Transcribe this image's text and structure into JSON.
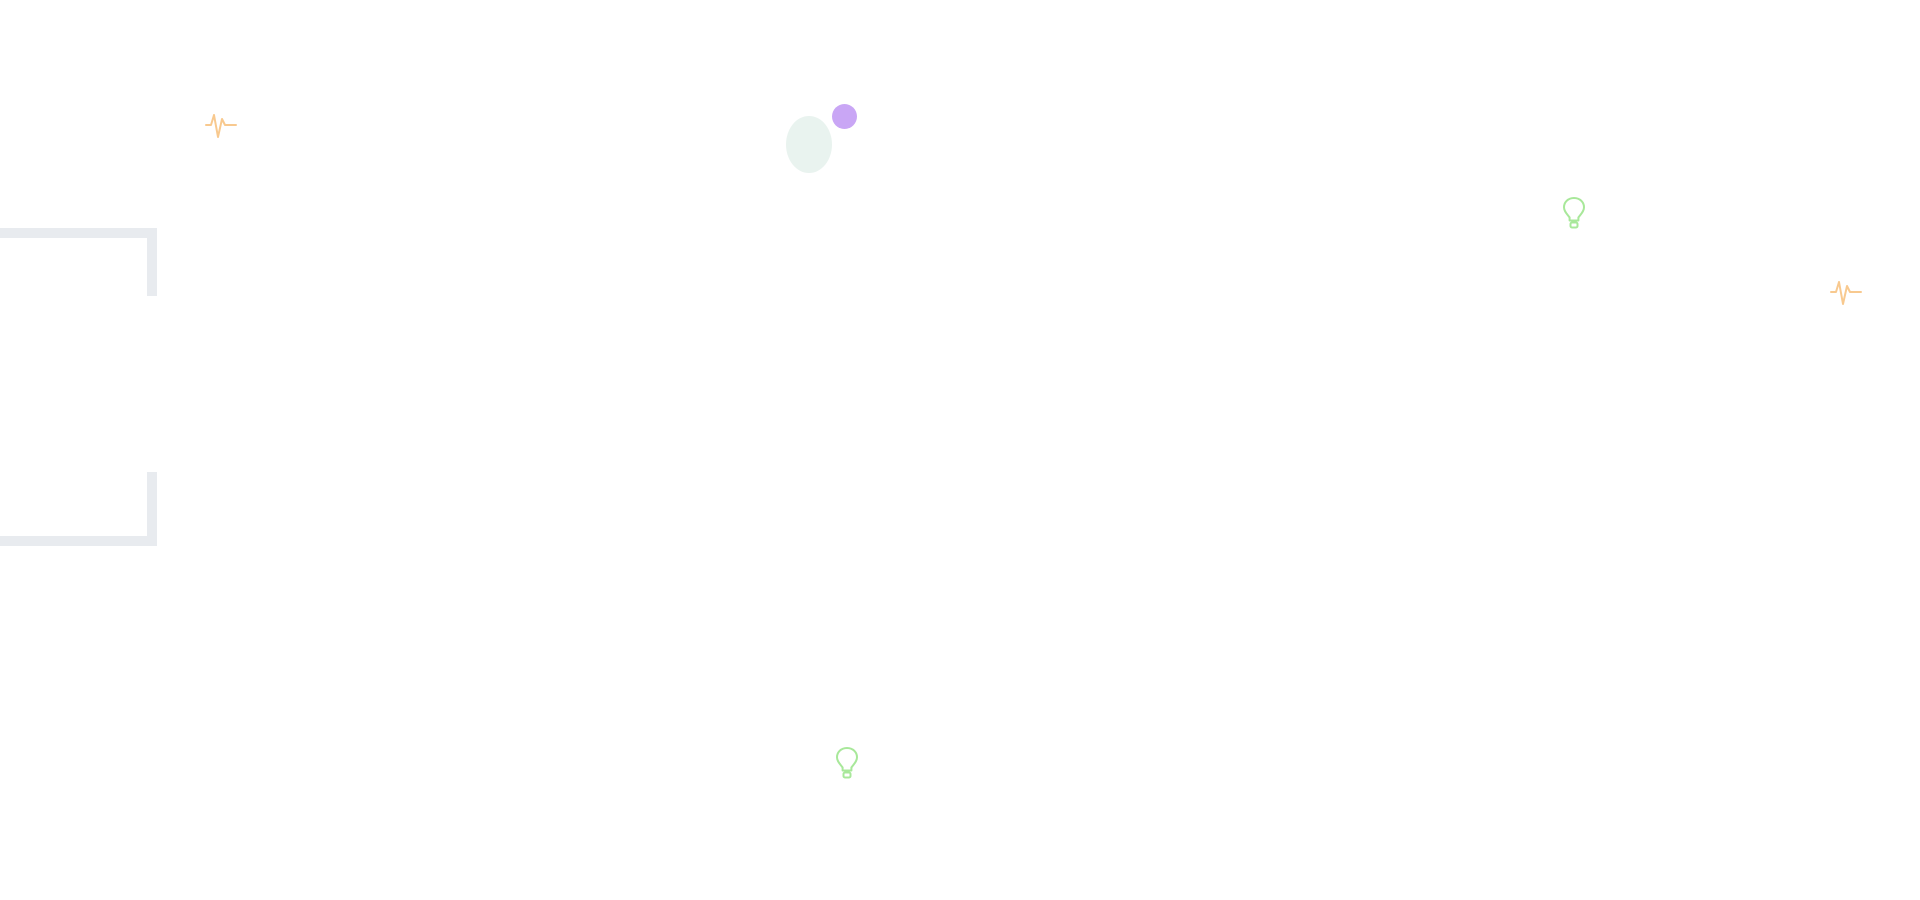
{
  "page": {
    "background_color": "#ffffff"
  },
  "decorations": {
    "bracket_color": "#e8ebef",
    "oval_color": "#e9f3ef",
    "dot_color": "#c9a6f5",
    "pulse_color": "#f8c98f",
    "bulb_color": "#a8e89a",
    "icons": [
      "pulse-icon",
      "pulse-icon",
      "lightbulb-icon",
      "lightbulb-icon"
    ]
  }
}
